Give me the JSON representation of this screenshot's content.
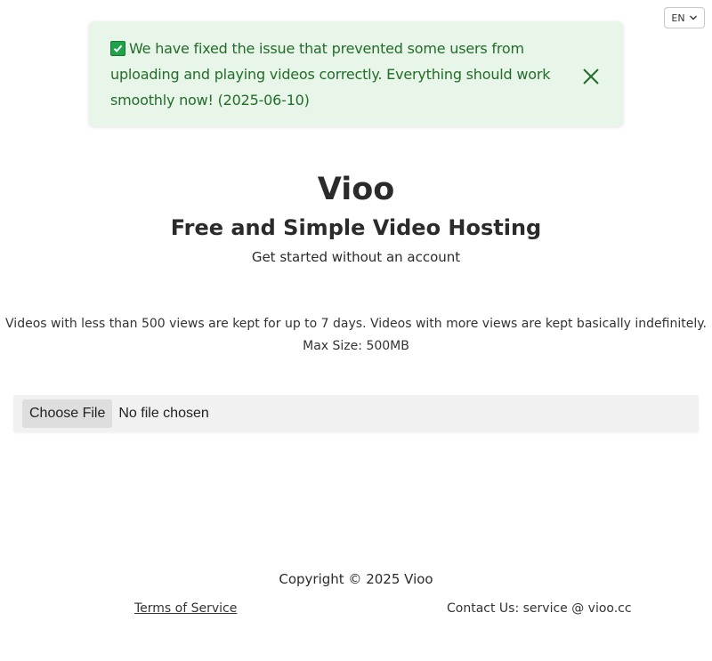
{
  "language_select": {
    "value": "EN",
    "icon": "chevron-down-icon"
  },
  "notice": {
    "icon": "check-mark-icon",
    "message": "We have fixed the issue that prevented some users from uploading and playing videos correctly. Everything should work smoothly now! (2025-06-10)",
    "close_icon": "close-icon",
    "colors": {
      "background": "#e8f5e9",
      "text": "#236c2a",
      "check": "#1fa24a"
    }
  },
  "hero": {
    "title": "Vioo",
    "subtitle": "Free and Simple Video Hosting",
    "tagline": "Get started without an account"
  },
  "info": {
    "retention": "Videos with less than 500 views are kept for up to 7 days. Videos with more views are kept basically indefinitely.",
    "max_size": "Max Size: 500MB"
  },
  "upload": {
    "button_label": "Choose File",
    "status": "No file chosen"
  },
  "footer": {
    "copyright": "Copyright © 2025 Vioo",
    "terms_link": "Terms of Service",
    "contact": "Contact Us: service @ vioo.cc"
  }
}
